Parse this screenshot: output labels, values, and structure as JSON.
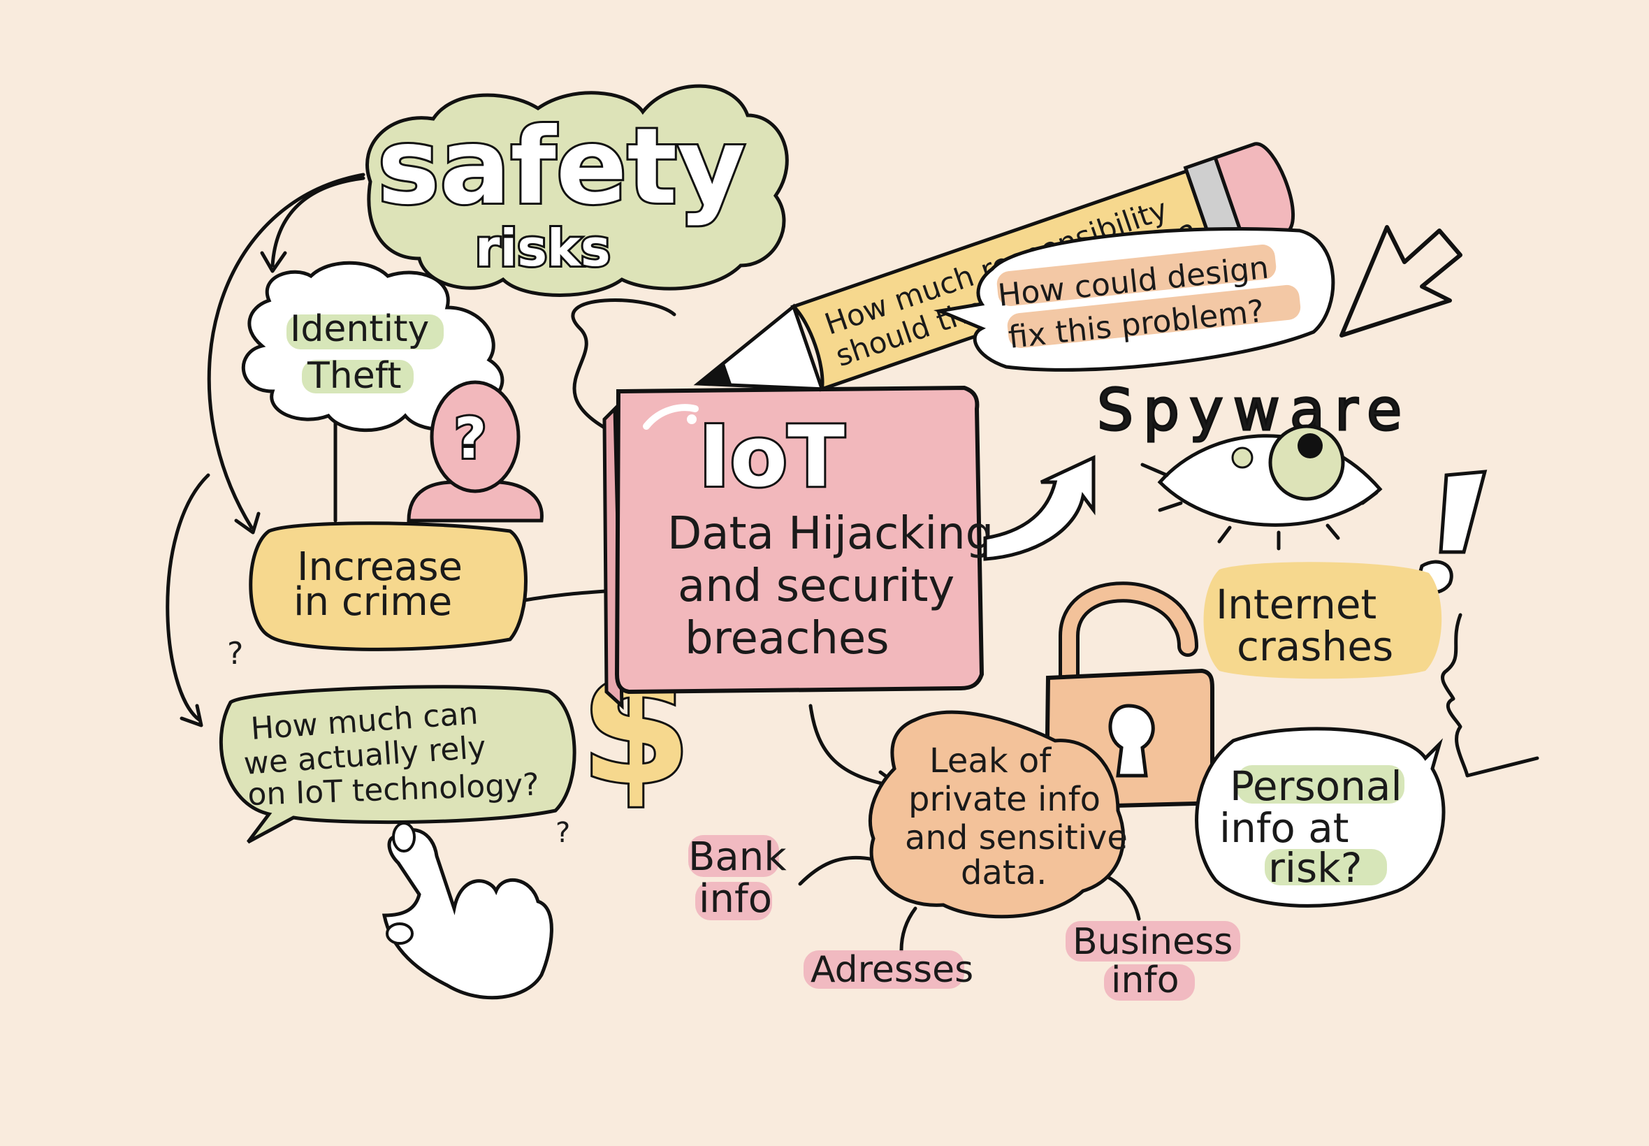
{
  "colors": {
    "background": "#F9EBDD",
    "green": "#DDE3B8",
    "pink": "#F2B8BC",
    "yellow": "#F6D88E",
    "peach": "#F3C29A",
    "ink": "#111111"
  },
  "center": {
    "title": "IoT",
    "line1": "Data Hijacking",
    "line2": "and security",
    "line3": "breaches"
  },
  "safety": {
    "title": "safety",
    "subtitle": "risks"
  },
  "identity": {
    "line1": "Identity",
    "line2": "Theft"
  },
  "crime": {
    "line1": "Increase",
    "line2": "in crime"
  },
  "rely": {
    "line1": "How much can",
    "line2": "we actually rely",
    "line3": "on IoT technology?"
  },
  "pencil": {
    "line1": "How much responsibility",
    "line2": "should the designer take?"
  },
  "design": {
    "line1": "How could design",
    "line2": "fix this problem?"
  },
  "spyware": {
    "label": "Spyware"
  },
  "internet": {
    "line1": "Internet",
    "line2": "crashes"
  },
  "personal": {
    "line1": "Personal",
    "line2": "info at",
    "line3": "risk?"
  },
  "leak": {
    "line1": "Leak of",
    "line2": "private info",
    "line3": "and sensitive",
    "line4": "data."
  },
  "bank": {
    "line1": "Bank",
    "line2": "info"
  },
  "addresses": {
    "label": "Adresses"
  },
  "business": {
    "line1": "Business",
    "line2": "info"
  },
  "symbols": {
    "question": "?",
    "exclamation": "!",
    "dollar": "$"
  },
  "icons": [
    "pencil-icon",
    "eye-icon",
    "padlock-icon",
    "dollar-icon",
    "pointing-hand-icon",
    "person-question-icon",
    "arrow-icon",
    "exclamation-icon",
    "face-profile-icon"
  ]
}
